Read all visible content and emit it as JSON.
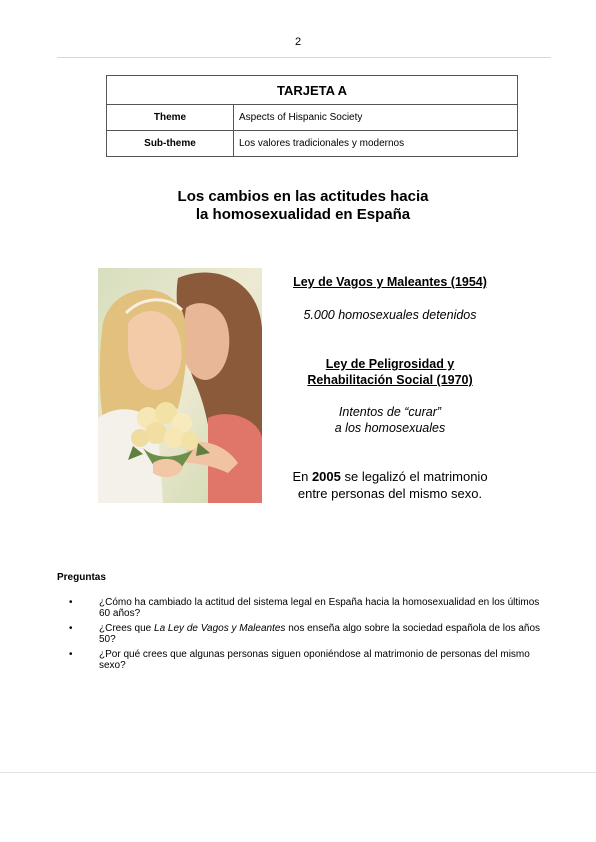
{
  "page_number": "2",
  "card": {
    "title": "TARJETA A",
    "rows": [
      {
        "label": "Theme",
        "value": "Aspects of Hispanic Society"
      },
      {
        "label": "Sub-theme",
        "value": "Los valores tradicionales y modernos"
      }
    ]
  },
  "title": {
    "line1": "Los cambios en las actitudes hacia",
    "line2": "la homosexualidad en España"
  },
  "laws": {
    "law1_title": "Ley de Vagos y Maleantes (1954)",
    "law1_note": "5.000 homosexuales detenidos",
    "law2_title_line1": "Ley de Peligrosidad y",
    "law2_title_line2": "Rehabilitación Social (1970)",
    "law2_note_line1": "Intentos de “curar”",
    "law2_note_line2": "a los homosexuales",
    "marriage_pre": "En ",
    "marriage_year": "2005",
    "marriage_post": " se legalizó el matrimonio",
    "marriage_line2": "entre personas del mismo sexo."
  },
  "questions": {
    "heading": "Preguntas",
    "bullet": "•",
    "items": [
      {
        "pre": "¿Cómo ha cambiado la actitud del sistema legal en España hacia la homosexualidad en los últimos 60 años?"
      },
      {
        "pre": "¿Crees que ",
        "italic": "La Ley de Vagos y Maleantes",
        "post": " nos enseña algo sobre la sociedad española de los años 50?"
      },
      {
        "pre": "¿Por qué crees que algunas personas siguen oponiéndose al matrimonio de personas del mismo sexo?"
      }
    ]
  },
  "photo": {
    "subject": "two women with bridal bouquet"
  },
  "colors": {
    "table_border": "#555555",
    "rule": "#d8d8d8"
  }
}
